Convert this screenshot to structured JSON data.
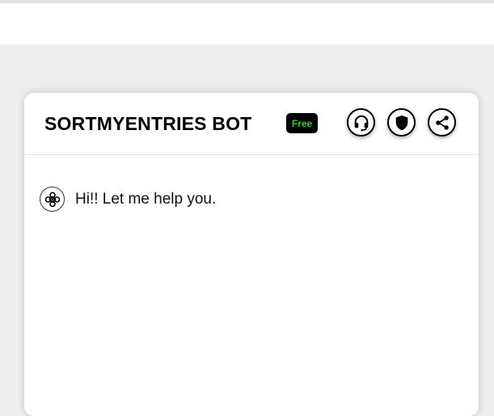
{
  "header": {
    "title": "SORTMYENTRIES BOT",
    "badge": "Free"
  },
  "header_actions": [
    {
      "icon": "headset-icon",
      "label": ""
    },
    {
      "icon": "shield-icon",
      "label": ""
    },
    {
      "icon": "share-icon",
      "label": ""
    }
  ],
  "chat": {
    "messages": [
      {
        "sender": "bot",
        "avatar_icon": "bot-logo-icon",
        "text": "Hi!! Let me help you."
      }
    ]
  },
  "colors": {
    "badge_background": "#000000",
    "badge_text": "#22d40f",
    "page_background": "#eeeeee",
    "card_background": "#ffffff"
  }
}
